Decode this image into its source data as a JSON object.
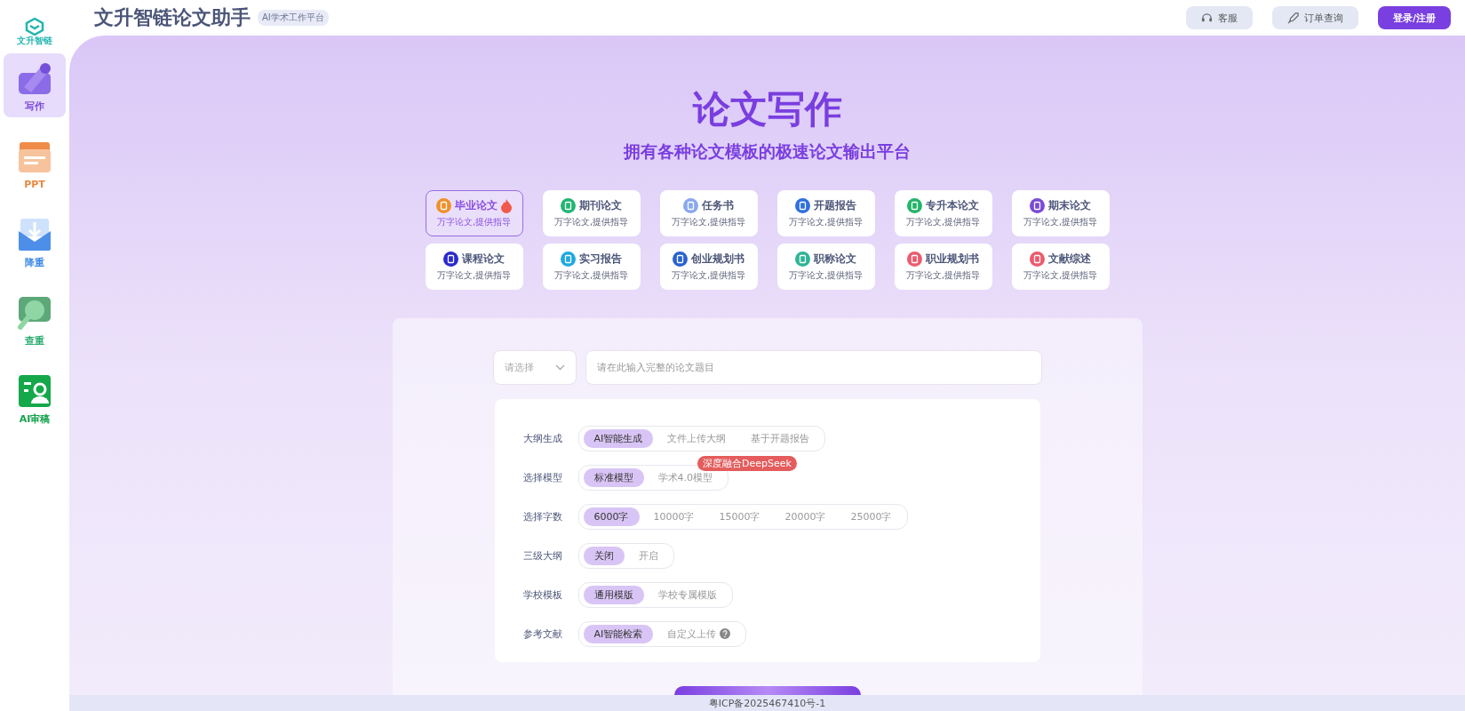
{
  "logo": {
    "text": "文升智链"
  },
  "header": {
    "title": "文升智链论文助手",
    "tag": "AI学术工作平台",
    "buttons": [
      {
        "label": "客服",
        "kind": "service"
      },
      {
        "label": "订单查询",
        "kind": "order"
      },
      {
        "label": "登录/注册",
        "kind": "primary"
      }
    ]
  },
  "sidebar": {
    "items": [
      {
        "label": "写作",
        "kind": "write",
        "selected": true,
        "color": "#7c4ddb"
      },
      {
        "label": "PPT",
        "kind": "ppt",
        "selected": false,
        "color": "#e9873f"
      },
      {
        "label": "降重",
        "kind": "reduce",
        "selected": false,
        "color": "#3f8ae6"
      },
      {
        "label": "查重",
        "kind": "check",
        "selected": false,
        "color": "#2fae73"
      },
      {
        "label": "AI审稿",
        "kind": "review",
        "selected": false,
        "color": "#13a34a"
      }
    ]
  },
  "hero": {
    "title": "论文写作",
    "subtitle": "拥有各种论文模板的极速论文输出平台"
  },
  "types": [
    {
      "title": "毕业论文",
      "desc": "万字论文,提供指导",
      "selected": true,
      "hot": true,
      "color": "#f0902a"
    },
    {
      "title": "期刊论文",
      "desc": "万字论文,提供指导",
      "selected": false,
      "hot": false,
      "color": "#22b573"
    },
    {
      "title": "任务书",
      "desc": "万字论文,提供指导",
      "selected": false,
      "hot": false,
      "color": "#8aa8f0"
    },
    {
      "title": "开题报告",
      "desc": "万字论文,提供指导",
      "selected": false,
      "hot": false,
      "color": "#2f6fe0"
    },
    {
      "title": "专升本论文",
      "desc": "万字论文,提供指导",
      "selected": false,
      "hot": false,
      "color": "#22b56a"
    },
    {
      "title": "期末论文",
      "desc": "万字论文,提供指导",
      "selected": false,
      "hot": false,
      "color": "#7a4bd6"
    },
    {
      "title": "课程论文",
      "desc": "万字论文,提供指导",
      "selected": false,
      "hot": false,
      "color": "#2a2ad0"
    },
    {
      "title": "实习报告",
      "desc": "万字论文,提供指导",
      "selected": false,
      "hot": false,
      "color": "#20a8e0"
    },
    {
      "title": "创业规划书",
      "desc": "万字论文,提供指导",
      "selected": false,
      "hot": false,
      "color": "#2a62d0"
    },
    {
      "title": "职称论文",
      "desc": "万字论文,提供指导",
      "selected": false,
      "hot": false,
      "color": "#2fb596"
    },
    {
      "title": "职业规划书",
      "desc": "万字论文,提供指导",
      "selected": false,
      "hot": false,
      "color": "#ec5a6e"
    },
    {
      "title": "文献综述",
      "desc": "万字论文,提供指导",
      "selected": false,
      "hot": false,
      "color": "#ec5a6e"
    }
  ],
  "form": {
    "select_placeholder": "请选择",
    "topic_placeholder": "请在此输入完整的论文题目",
    "settings": [
      {
        "label": "大纲生成",
        "options": [
          {
            "label": "AI智能生成",
            "selected": true
          },
          {
            "label": "文件上传大纲",
            "selected": false
          },
          {
            "label": "基于开题报告",
            "selected": false
          }
        ]
      },
      {
        "label": "选择模型",
        "badge": "深度融合DeepSeek",
        "options": [
          {
            "label": "标准模型",
            "selected": true
          },
          {
            "label": "学术4.0模型",
            "selected": false
          }
        ]
      },
      {
        "label": "选择字数",
        "options": [
          {
            "label": "6000字",
            "selected": true
          },
          {
            "label": "10000字",
            "selected": false
          },
          {
            "label": "15000字",
            "selected": false
          },
          {
            "label": "20000字",
            "selected": false
          },
          {
            "label": "25000字",
            "selected": false
          }
        ]
      },
      {
        "label": "三级大纲",
        "options": [
          {
            "label": "关闭",
            "selected": true
          },
          {
            "label": "开启",
            "selected": false
          }
        ]
      },
      {
        "label": "学校模板",
        "options": [
          {
            "label": "通用模版",
            "selected": true
          },
          {
            "label": "学校专属模版",
            "selected": false
          }
        ]
      },
      {
        "label": "参考文献",
        "options": [
          {
            "label": "AI智能检索",
            "selected": true
          },
          {
            "label": "自定义上传",
            "selected": false,
            "help": true
          }
        ]
      }
    ]
  },
  "footer": {
    "text": "粤ICP备2025467410号-1"
  }
}
